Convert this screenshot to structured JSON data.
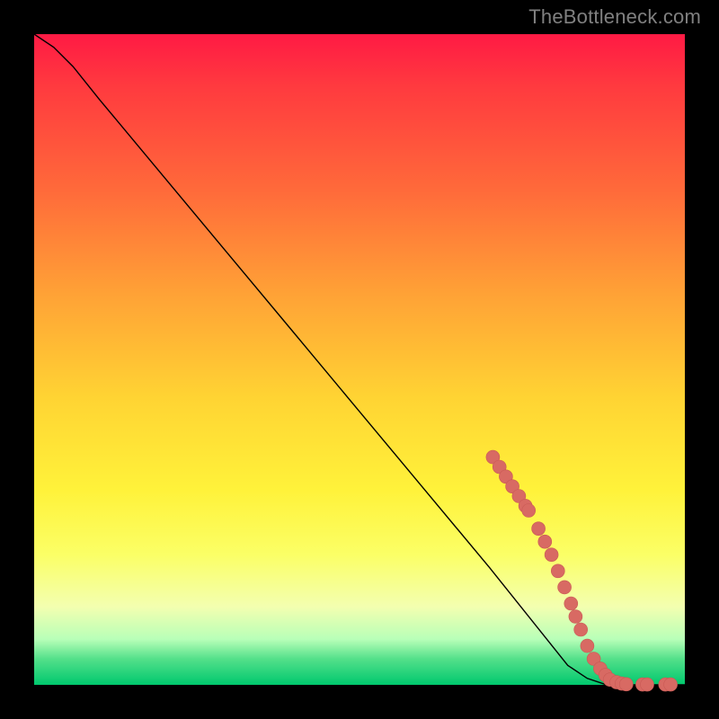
{
  "watermark": "TheBottleneck.com",
  "colors": {
    "marker_fill": "#d86a63",
    "marker_stroke": "#c95a55",
    "curve": "#000000",
    "frame_bg": "#000000"
  },
  "chart_data": {
    "type": "line",
    "title": "",
    "xlabel": "",
    "ylabel": "",
    "xlim": [
      0,
      100
    ],
    "ylim": [
      0,
      100
    ],
    "curve": [
      {
        "x": 0,
        "y": 100
      },
      {
        "x": 3,
        "y": 98
      },
      {
        "x": 6,
        "y": 95
      },
      {
        "x": 10,
        "y": 90
      },
      {
        "x": 20,
        "y": 78
      },
      {
        "x": 30,
        "y": 66
      },
      {
        "x": 40,
        "y": 54
      },
      {
        "x": 50,
        "y": 42
      },
      {
        "x": 60,
        "y": 30
      },
      {
        "x": 70,
        "y": 18
      },
      {
        "x": 78,
        "y": 8
      },
      {
        "x": 82,
        "y": 3
      },
      {
        "x": 85,
        "y": 1
      },
      {
        "x": 88,
        "y": 0
      },
      {
        "x": 100,
        "y": 0
      }
    ],
    "markers": [
      {
        "x": 70.5,
        "y": 35.0
      },
      {
        "x": 71.5,
        "y": 33.5
      },
      {
        "x": 72.5,
        "y": 32.0
      },
      {
        "x": 73.5,
        "y": 30.5
      },
      {
        "x": 74.5,
        "y": 29.0
      },
      {
        "x": 75.5,
        "y": 27.5
      },
      {
        "x": 76.0,
        "y": 26.8
      },
      {
        "x": 77.5,
        "y": 24.0
      },
      {
        "x": 78.5,
        "y": 22.0
      },
      {
        "x": 79.5,
        "y": 20.0
      },
      {
        "x": 80.5,
        "y": 17.5
      },
      {
        "x": 81.5,
        "y": 15.0
      },
      {
        "x": 82.5,
        "y": 12.5
      },
      {
        "x": 83.2,
        "y": 10.5
      },
      {
        "x": 84.0,
        "y": 8.5
      },
      {
        "x": 85.0,
        "y": 6.0
      },
      {
        "x": 86.0,
        "y": 4.0
      },
      {
        "x": 87.0,
        "y": 2.5
      },
      {
        "x": 87.8,
        "y": 1.5
      },
      {
        "x": 88.5,
        "y": 0.8
      },
      {
        "x": 89.5,
        "y": 0.4
      },
      {
        "x": 90.3,
        "y": 0.2
      },
      {
        "x": 91.0,
        "y": 0.1
      },
      {
        "x": 93.5,
        "y": 0.05
      },
      {
        "x": 94.2,
        "y": 0.05
      },
      {
        "x": 97.0,
        "y": 0.05
      },
      {
        "x": 97.8,
        "y": 0.05
      }
    ]
  }
}
